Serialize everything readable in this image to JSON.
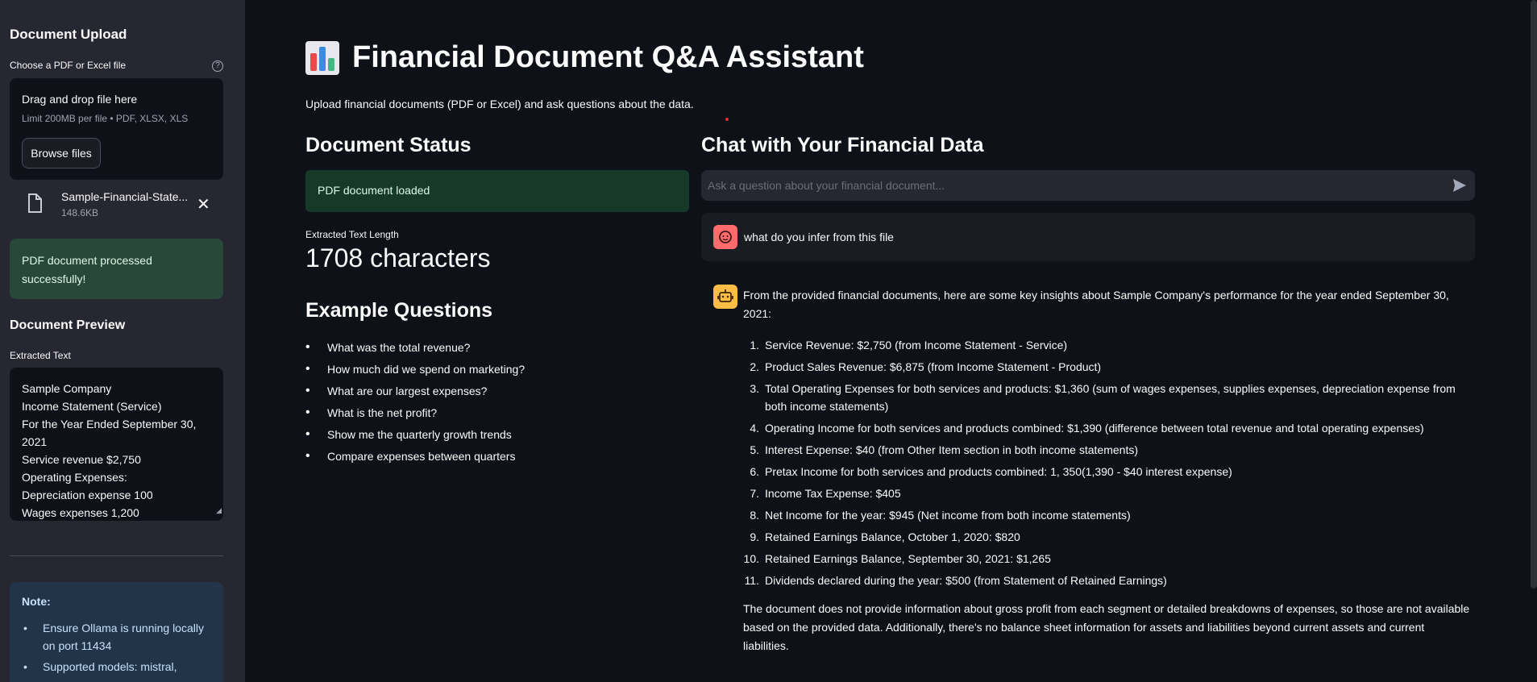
{
  "sidebar": {
    "title": "Document Upload",
    "uploader_label": "Choose a PDF or Excel file",
    "help_icon": "question-circle-icon",
    "dropzone": {
      "title": "Drag and drop file here",
      "limit": "Limit 200MB per file • PDF, XLSX, XLS",
      "browse_label": "Browse files"
    },
    "file": {
      "name": "Sample-Financial-State...",
      "size": "148.6KB",
      "close_icon": "close-icon"
    },
    "success_message": "PDF document processed successfully!",
    "preview_title": "Document Preview",
    "preview_label": "Extracted Text",
    "preview_lines": [
      "Sample Company",
      "Income Statement (Service)",
      "For the Year Ended September 30,",
      "2021",
      "Service revenue $2,750",
      "Operating Expenses:",
      "Depreciation expense 100",
      "Wages expenses 1,200"
    ],
    "note": {
      "title": "Note:",
      "items": [
        "Ensure Ollama is running locally on port 11434",
        "Supported models: mistral,"
      ]
    }
  },
  "main": {
    "title": "Financial Document Q&A Assistant",
    "title_icon": "bar-chart-icon",
    "subtitle": "Upload financial documents (PDF or Excel) and ask questions about the data.",
    "status": {
      "heading": "Document Status",
      "message": "PDF document loaded",
      "metric_label": "Extracted Text Length",
      "metric_value": "1708 characters"
    },
    "examples": {
      "heading": "Example Questions",
      "items": [
        "What was the total revenue?",
        "How much did we spend on marketing?",
        "What are our largest expenses?",
        "What is the net profit?",
        "Show me the quarterly growth trends",
        "Compare expenses between quarters"
      ]
    },
    "chat": {
      "heading": "Chat with Your Financial Data",
      "placeholder": "Ask a question about your financial document...",
      "send_icon": "send-icon",
      "user_message": "what do you infer from this file",
      "bot_intro": "From the provided financial documents, here are some key insights about Sample Company's performance for the year ended September 30, 2021:",
      "bot_items": [
        "Service Revenue: $2,750 (from Income Statement - Service)",
        "Product Sales Revenue: $6,875 (from Income Statement - Product)",
        "Total Operating Expenses for both services and products: $1,360 (sum of wages expenses, supplies expenses, depreciation expense from both income statements)",
        "Operating Income for both services and products combined: $1,390 (difference between total revenue and total operating expenses)",
        "Interest Expense: $40 (from Other Item section in both income statements)",
        "Pretax Income for both services and products combined: 1, 350(1,390 - $40 interest expense)",
        "Income Tax Expense: $405",
        "Net Income for the year: $945 (Net income from both income statements)",
        "Retained Earnings Balance, October 1, 2020: $820",
        "Retained Earnings Balance, September 30, 2021: $1,265",
        "Dividends declared during the year: $500 (from Statement of Retained Earnings)"
      ],
      "bot_outro": "The document does not provide information about gross profit from each segment or detailed breakdowns of expenses, so those are not available based on the provided data. Additionally, there's no balance sheet information for assets and liabilities beyond current assets and current liabilities."
    }
  },
  "colors": {
    "background": "#0e1117",
    "sidebar": "#262730",
    "success": "#28483a",
    "info": "#223448",
    "user_avatar": "#ff6b6b",
    "bot_avatar": "#ffbd45"
  }
}
